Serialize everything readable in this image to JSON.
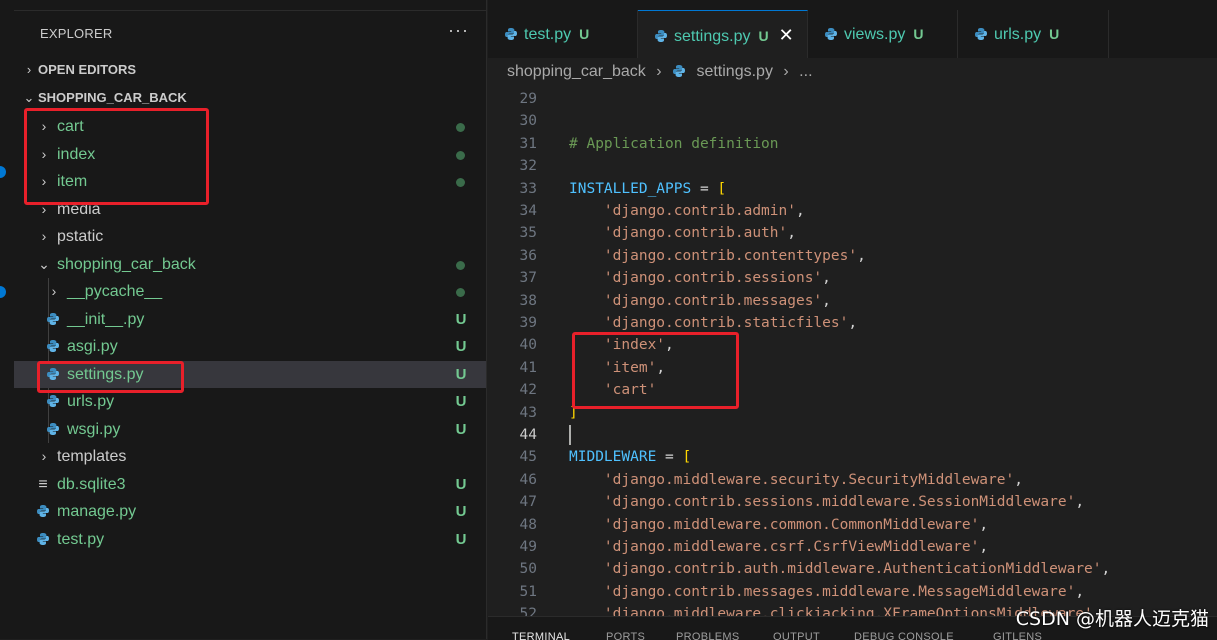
{
  "colors": {
    "accent": "#0078d4",
    "folder_green": "#73c991",
    "git_untracked": "#73c991",
    "highlight_red": "#e8202a",
    "string": "#ce9178",
    "comment": "#6a9955",
    "variable": "#4fc1ff",
    "bracket": "#ffd700"
  },
  "explorer": {
    "title": "EXPLORER",
    "more_icon": "ellipsis-icon",
    "open_editors_label": "OPEN EDITORS",
    "project_label": "SHOPPING_CAR_BACK",
    "tree": [
      {
        "label": "cart",
        "kind": "folder",
        "expanded": false,
        "git": "dot"
      },
      {
        "label": "index",
        "kind": "folder",
        "expanded": false,
        "git": "dot"
      },
      {
        "label": "item",
        "kind": "folder",
        "expanded": false,
        "git": "dot"
      },
      {
        "label": "media",
        "kind": "folder",
        "expanded": false,
        "git": ""
      },
      {
        "label": "pstatic",
        "kind": "folder",
        "expanded": false,
        "git": ""
      },
      {
        "label": "shopping_car_back",
        "kind": "folder",
        "expanded": true,
        "git": "dot"
      },
      {
        "label": "__pycache__",
        "kind": "folder",
        "expanded": false,
        "git": "dot"
      },
      {
        "label": "__init__.py",
        "kind": "python",
        "git": "U"
      },
      {
        "label": "asgi.py",
        "kind": "python",
        "git": "U"
      },
      {
        "label": "settings.py",
        "kind": "python",
        "git": "U"
      },
      {
        "label": "urls.py",
        "kind": "python",
        "git": "U"
      },
      {
        "label": "wsgi.py",
        "kind": "python",
        "git": "U"
      },
      {
        "label": "templates",
        "kind": "folder",
        "expanded": false,
        "git": ""
      },
      {
        "label": "db.sqlite3",
        "kind": "database",
        "git": "U"
      },
      {
        "label": "manage.py",
        "kind": "python",
        "git": "U"
      },
      {
        "label": "test.py",
        "kind": "python",
        "git": "U"
      }
    ]
  },
  "tabs": [
    {
      "label": "test.py",
      "status": "U",
      "active": false
    },
    {
      "label": "settings.py",
      "status": "U",
      "active": true
    },
    {
      "label": "views.py",
      "status": "U",
      "active": false
    },
    {
      "label": "urls.py",
      "status": "U",
      "active": false
    }
  ],
  "breadcrumbs": {
    "folder": "shopping_car_back",
    "separator": "›",
    "file": "settings.py",
    "tail": "..."
  },
  "editor": {
    "current_line": "44",
    "lines": [
      {
        "n": "29",
        "text": ""
      },
      {
        "n": "30",
        "text": ""
      },
      {
        "n": "31",
        "text": "# Application definition"
      },
      {
        "n": "32",
        "text": ""
      },
      {
        "n": "33",
        "text": "INSTALLED_APPS = ["
      },
      {
        "n": "34",
        "text": "    'django.contrib.admin',"
      },
      {
        "n": "35",
        "text": "    'django.contrib.auth',"
      },
      {
        "n": "36",
        "text": "    'django.contrib.contenttypes',"
      },
      {
        "n": "37",
        "text": "    'django.contrib.sessions',"
      },
      {
        "n": "38",
        "text": "    'django.contrib.messages',"
      },
      {
        "n": "39",
        "text": "    'django.contrib.staticfiles',"
      },
      {
        "n": "40",
        "text": "    'index',"
      },
      {
        "n": "41",
        "text": "    'item',"
      },
      {
        "n": "42",
        "text": "    'cart'"
      },
      {
        "n": "43",
        "text": "]"
      },
      {
        "n": "44",
        "text": ""
      },
      {
        "n": "45",
        "text": "MIDDLEWARE = ["
      },
      {
        "n": "46",
        "text": "    'django.middleware.security.SecurityMiddleware',"
      },
      {
        "n": "47",
        "text": "    'django.contrib.sessions.middleware.SessionMiddleware',"
      },
      {
        "n": "48",
        "text": "    'django.middleware.common.CommonMiddleware',"
      },
      {
        "n": "49",
        "text": "    'django.middleware.csrf.CsrfViewMiddleware',"
      },
      {
        "n": "50",
        "text": "    'django.contrib.auth.middleware.AuthenticationMiddleware',"
      },
      {
        "n": "51",
        "text": "    'django.contrib.messages.middleware.MessageMiddleware',"
      },
      {
        "n": "52",
        "text": "    'django.middleware.clickjacking.XFrameOptionsMiddleware',"
      }
    ]
  },
  "panel_tabs": [
    "TERMINAL",
    "PORTS",
    "PROBLEMS",
    "OUTPUT",
    "DEBUG CONSOLE",
    "GITLENS"
  ],
  "watermark": "CSDN @机器人迈克猫"
}
